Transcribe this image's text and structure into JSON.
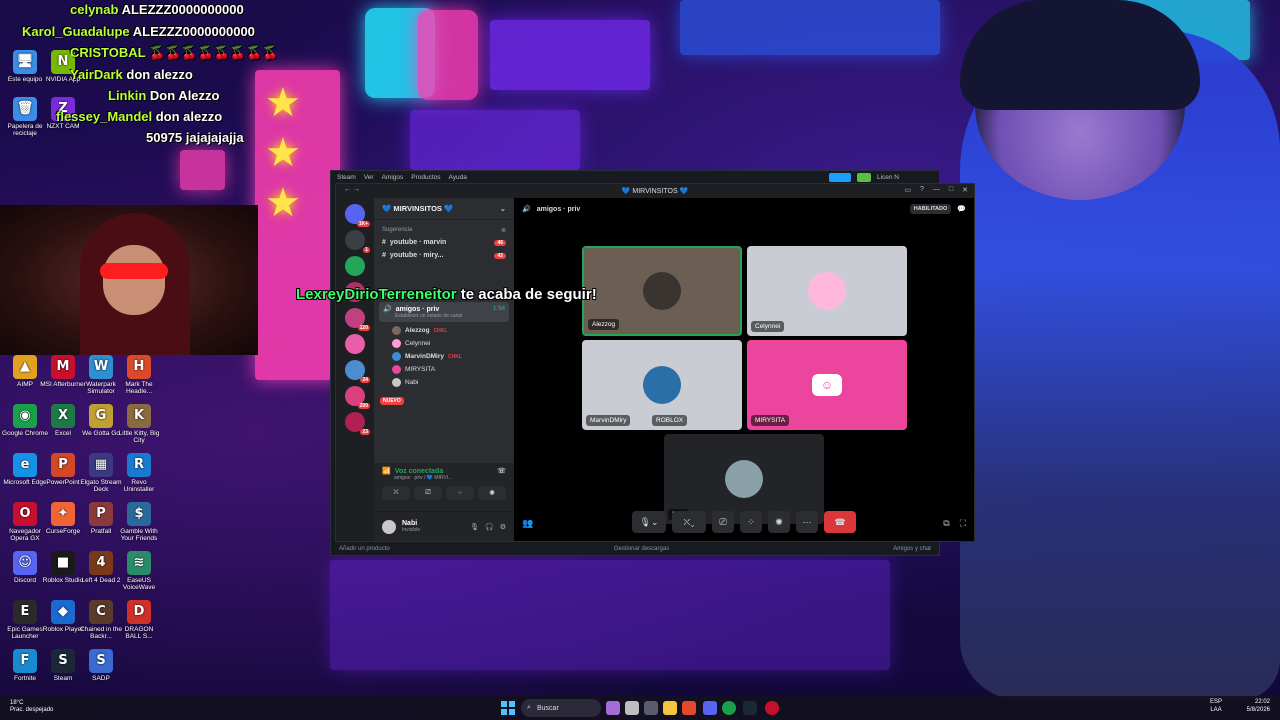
{
  "chat": [
    {
      "user": "celynab",
      "msg": "ALEZZZ0000000000"
    },
    {
      "user": "Karol_Guadalupe",
      "msg": "ALEZZZ0000000000"
    },
    {
      "user": "CRISTOBAL",
      "msg": "🍒🍒🍒🍒🍒🍒🍒🍒"
    },
    {
      "user": "YairDark",
      "msg": "don alezzo"
    },
    {
      "user": "Linkin",
      "msg": "Don Alezzo"
    },
    {
      "user": "flessey_Mandel",
      "msg": "don alezzo"
    },
    {
      "user": "",
      "msg": "50975 jajajajajja"
    }
  ],
  "follow_alert": {
    "user": "LexreyDirioTerreneitor",
    "text": "te acaba de seguir!"
  },
  "desktop_icons": [
    {
      "label": "Este equipo",
      "glyph": "🖥"
    },
    {
      "label": "Papelera de reciclaje",
      "glyph": "🗑"
    },
    {
      "label": "NVIDIA App",
      "glyph": "N"
    },
    {
      "label": "NZXT CAM",
      "glyph": "Z"
    },
    {
      "label": "AIMP",
      "glyph": "▲"
    },
    {
      "label": "MSI Afterburner",
      "glyph": "M"
    },
    {
      "label": "Waterpark Simulator",
      "glyph": "W"
    },
    {
      "label": "Mark The Headle...",
      "glyph": "H"
    },
    {
      "label": "Google Chrome",
      "glyph": "◉"
    },
    {
      "label": "Excel",
      "glyph": "X"
    },
    {
      "label": "We Gotta Go",
      "glyph": "G"
    },
    {
      "label": "Little Kitty, Big City",
      "glyph": "K"
    },
    {
      "label": "Microsoft Edge",
      "glyph": "e"
    },
    {
      "label": "PowerPoint",
      "glyph": "P"
    },
    {
      "label": "Elgato Stream Deck",
      "glyph": "▦"
    },
    {
      "label": "Revo Uninstaller",
      "glyph": "R"
    },
    {
      "label": "Navegador Opera GX",
      "glyph": "O"
    },
    {
      "label": "CurseForge",
      "glyph": "✦"
    },
    {
      "label": "Pratfall",
      "glyph": "P"
    },
    {
      "label": "Gamble With Your Friends",
      "glyph": "$"
    },
    {
      "label": "Discord",
      "glyph": "☺"
    },
    {
      "label": "Roblox Studio",
      "glyph": "■"
    },
    {
      "label": "Left 4 Dead 2",
      "glyph": "4"
    },
    {
      "label": "EaseUS VoiceWave",
      "glyph": "≋"
    },
    {
      "label": "Epic Games Launcher",
      "glyph": "E"
    },
    {
      "label": "Roblox Player",
      "glyph": "◆"
    },
    {
      "label": "Chained in the Backr...",
      "glyph": "C"
    },
    {
      "label": "DRAGON BALL S...",
      "glyph": "D"
    },
    {
      "label": "Fortnite",
      "glyph": "F"
    },
    {
      "label": "Steam",
      "glyph": "S"
    },
    {
      "label": "SADP",
      "glyph": "S"
    }
  ],
  "steam": {
    "menu": [
      "Steam",
      "Ver",
      "Amigos",
      "Productos",
      "Ayuda"
    ],
    "account": "Licen N",
    "footer_left": "Añadir un producto",
    "footer_center": "Gestionar descargas",
    "footer_right": "Amigos y chat"
  },
  "discord": {
    "window_title": "💙 MIRVINSITOS 💙",
    "guild_name": "💙 MIRVINSITOS 💙",
    "section_suggest": "Sugerencia",
    "channels": [
      {
        "name": "youtube · marvin",
        "badge": "46"
      },
      {
        "name": "youtube · miry...",
        "badge": "42"
      }
    ],
    "voice_channel_1": "amigos",
    "voice_channel_2": "amigos · priv",
    "voice_time": "1:54",
    "voice_status": "Establecer un estado de canal",
    "voice_users": [
      {
        "name": "Alezzog",
        "tag": "CHKL",
        "color": "#7a6a5e"
      },
      {
        "name": "Celynnei",
        "tag": "",
        "color": "#ff9ed2"
      },
      {
        "name": "MarvinDMiry",
        "tag": "CHKL",
        "color": "#3b8ed0"
      },
      {
        "name": "MIRYSITA",
        "tag": "",
        "color": "#eb459e"
      },
      {
        "name": "Nabi",
        "tag": "",
        "color": "#c8c8c8"
      }
    ],
    "new_badge": "NUEVO",
    "connected_label": "Voz conectada",
    "connected_path": "amigos · priv / 💙 MIRVI...",
    "me_name": "Nabi",
    "me_status": "Invisible",
    "stage_title": "amigos · priv",
    "enabled_label": "HABILITADO",
    "tiles": [
      {
        "name": "Alezzog",
        "bg": "#6b5f54",
        "avatar": "#3a3430"
      },
      {
        "name": "Celynnei",
        "bg": "#c9ccd2",
        "avatar": "#ffb7dc"
      },
      {
        "name": "MarvinDMiry",
        "bg": "#c9ccd2",
        "avatar": "#2a6fa8",
        "pill": "ROBLOX"
      },
      {
        "name": "MIRYSITA",
        "bg": "#eb459e",
        "avatar": "#eb459e"
      },
      {
        "name": "Nabi",
        "bg": "#232428",
        "avatar": "#8aa0a8"
      }
    ],
    "servers": [
      {
        "color": "#5865f2",
        "badge": "1K+"
      },
      {
        "color": "#3b3f45",
        "badge": "1"
      },
      {
        "color": "#23a55a",
        "badge": ""
      },
      {
        "color": "#b0306a",
        "badge": ""
      },
      {
        "color": "#c04080",
        "badge": "120"
      },
      {
        "color": "#e85fa8",
        "badge": ""
      },
      {
        "color": "#4e8cd0",
        "badge": "24"
      },
      {
        "color": "#d94080",
        "badge": "200"
      },
      {
        "color": "#b02050",
        "badge": "23"
      }
    ]
  },
  "taskbar": {
    "weather_temp": "18°C",
    "weather_desc": "Prac. despejado",
    "search_placeholder": "Buscar",
    "lang_top": "ESP",
    "lang_bottom": "LAA",
    "time": "22:02",
    "date": "5/8/2026"
  },
  "colors": {
    "discord_blurple": "#5865f2",
    "end_call": "#da373c",
    "chat_user": "#b9ff3c",
    "follow_user": "#3cff6a"
  }
}
